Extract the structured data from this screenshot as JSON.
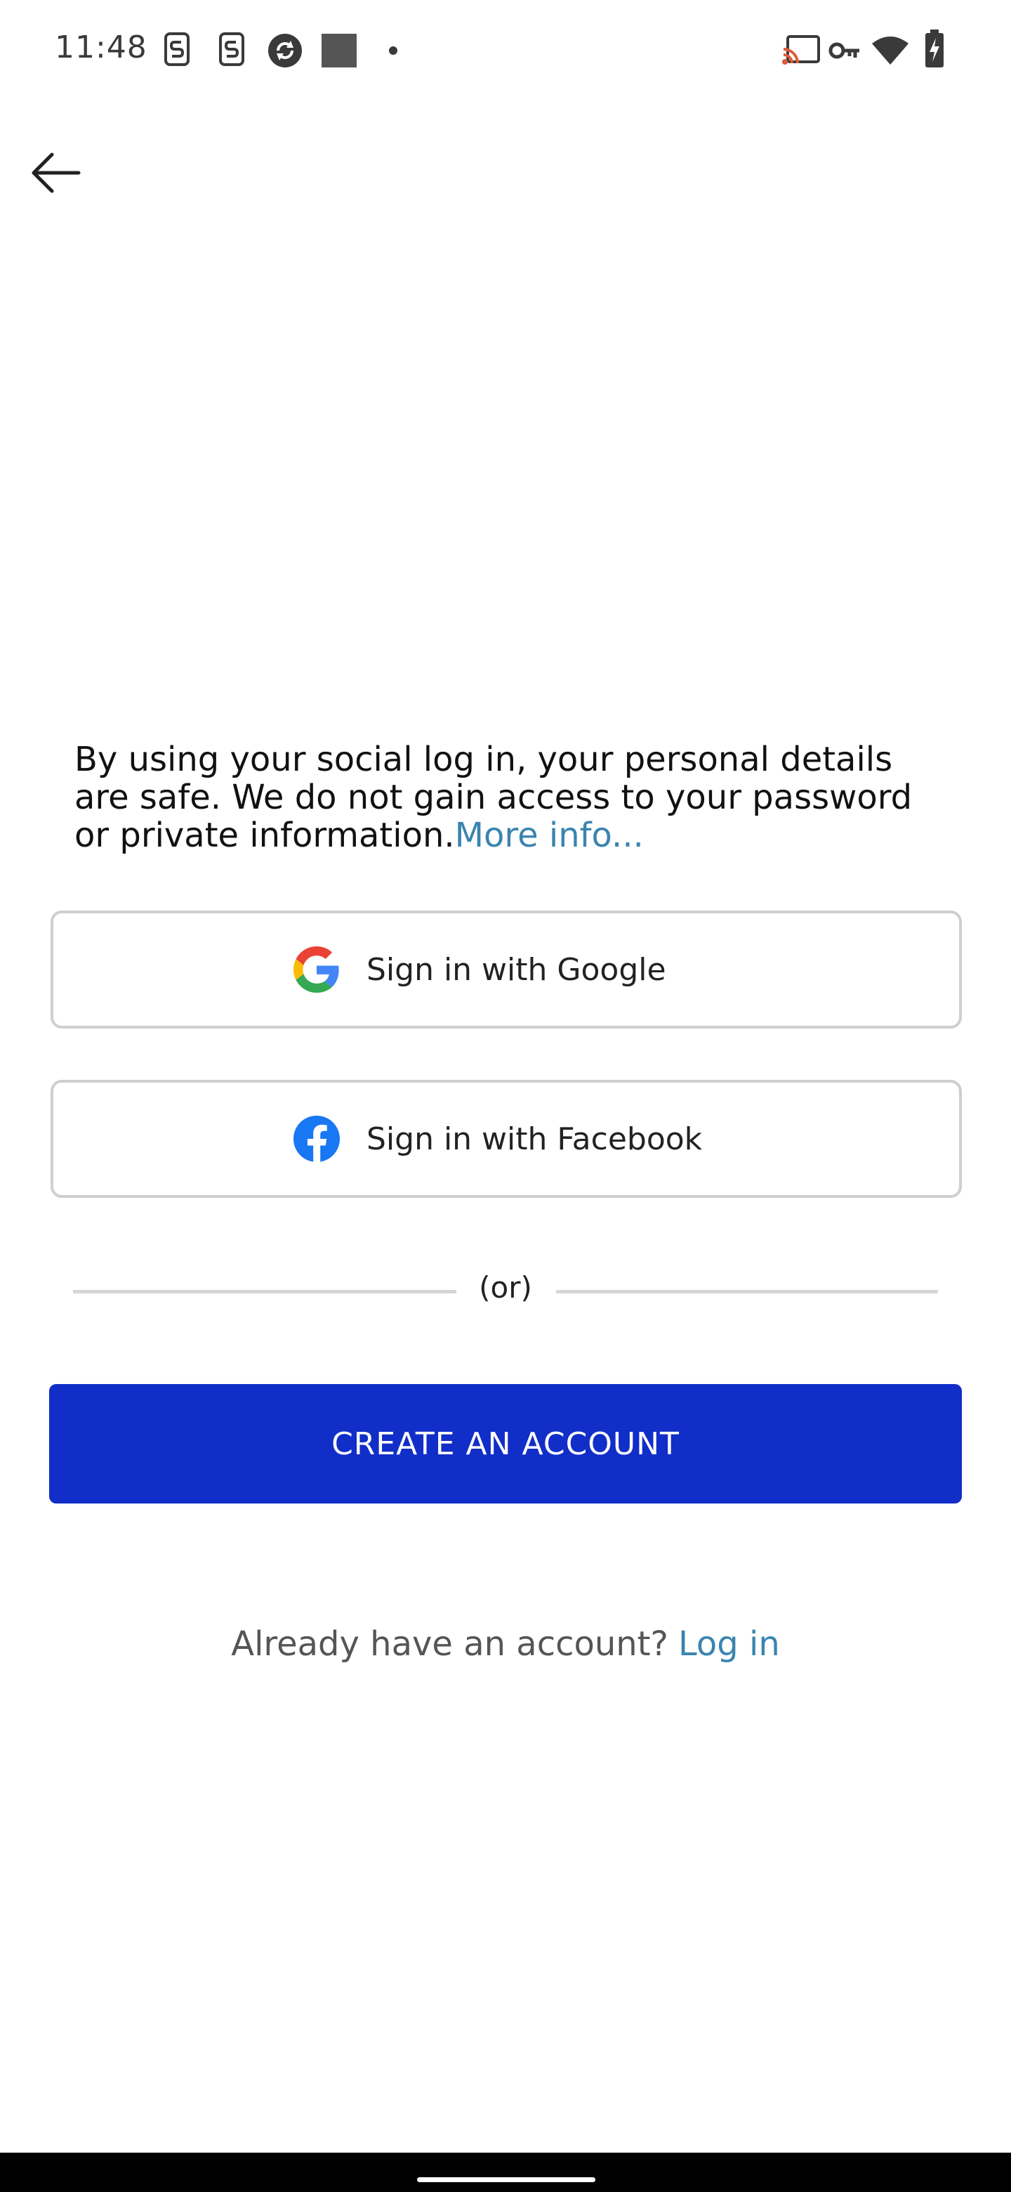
{
  "status_bar": {
    "time": "11:48",
    "left_icons": [
      "sim-s-icon",
      "sim-s-icon",
      "sync-icon",
      "square-icon",
      "dot-icon"
    ],
    "right_icons": [
      "cast-icon",
      "vpn-key-icon",
      "wifi-icon",
      "battery-charging-icon"
    ]
  },
  "nav": {
    "back_icon": "arrow-left-icon"
  },
  "disclaimer": {
    "text": "By using your social log in, your personal details are safe. We do not gain access to your password or private information.",
    "link": "More info..."
  },
  "social": {
    "google_label": "Sign in with Google",
    "facebook_label": "Sign in with Facebook"
  },
  "divider": {
    "text": "(or)"
  },
  "create_account": {
    "label": "CREATE AN ACCOUNT"
  },
  "login": {
    "prompt": "Already have an account?",
    "link": "Log in"
  },
  "colors": {
    "primary": "#112ec8",
    "link": "#3a84b0",
    "border": "#cfcfcf",
    "facebook": "#1877f2"
  }
}
